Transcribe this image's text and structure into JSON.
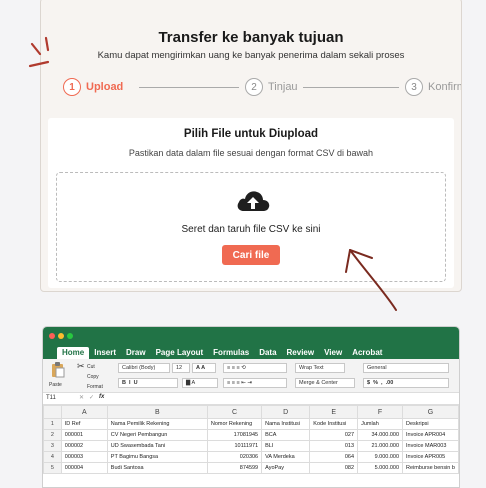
{
  "header": {
    "title": "Transfer ke banyak tujuan",
    "subtitle": "Kamu dapat mengirimkan uang ke banyak penerima dalam sekali proses"
  },
  "stepper": {
    "steps": [
      {
        "number": "1",
        "label": "Upload",
        "active": true
      },
      {
        "number": "2",
        "label": "Tinjau",
        "active": false
      },
      {
        "number": "3",
        "label": "Konfirmasi",
        "active": false
      }
    ]
  },
  "upload": {
    "title": "Pilih File untuk Diupload",
    "subtitle": "Pastikan data dalam file sesuai dengan format CSV di bawah",
    "drop_text": "Seret dan taruh file CSV ke sini",
    "browse_label": "Cari file",
    "icon": "cloud-upload-icon"
  },
  "colors": {
    "accent": "#f06a52",
    "excel_green": "#217346"
  },
  "spreadsheet": {
    "tabs": [
      "Home",
      "Insert",
      "Draw",
      "Page Layout",
      "Formulas",
      "Data",
      "Review",
      "View",
      "Acrobat"
    ],
    "active_tab": "Home",
    "toolbar": {
      "paste": "Paste",
      "cut": "Cut",
      "copy": "Copy",
      "format": "Format",
      "font": "Calibri (Body)",
      "size": "12",
      "wrap": "Wrap Text",
      "merge": "Merge & Center",
      "number_format": "General"
    },
    "cell_ref": "T11",
    "fx": "fx",
    "columns": [
      "",
      "A",
      "B",
      "C",
      "D",
      "E",
      "F",
      "G"
    ],
    "rows": [
      [
        "1",
        "ID Ref",
        "Nama Pemilik Rekening",
        "Nomor Rekening",
        "Nama Institusi",
        "Kode Institusi",
        "Jumlah",
        "Deskripsi"
      ],
      [
        "2",
        "000001",
        "CV Negeri Pembangun",
        "17081945",
        "BCA",
        "027",
        "34.000.000",
        "Invoice APR004"
      ],
      [
        "3",
        "000002",
        "UD Swasembada Tani",
        "10111971",
        "BLI",
        "013",
        "21.000.000",
        "Invoice MAR003"
      ],
      [
        "4",
        "000003",
        "PT Bagimu Bangsa",
        "020306",
        "VA Merdeka",
        "064",
        "9.000.000",
        "Invoice APR005"
      ],
      [
        "5",
        "000004",
        "Budi Santosa",
        "874599",
        "AyoPay",
        "082",
        "5.000.000",
        "Reimburse bensin b"
      ]
    ]
  }
}
